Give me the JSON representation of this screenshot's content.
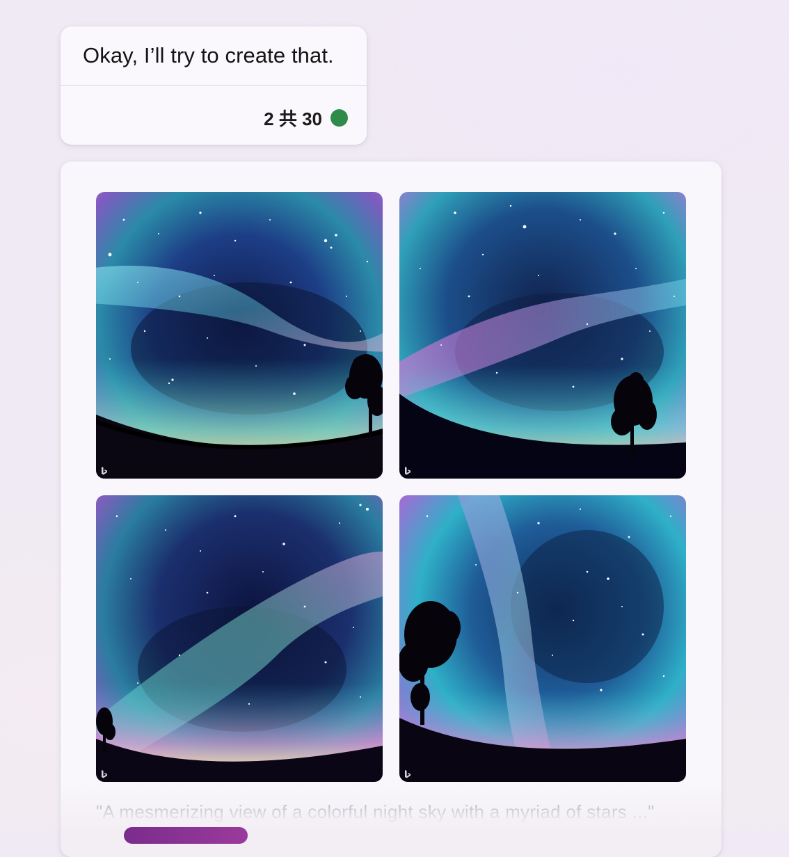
{
  "message": {
    "text": "Okay, I’ll try to create that.",
    "turn_counter": "2 共 30",
    "status_color": "#2e8b4a"
  },
  "image_grid": {
    "images": [
      {
        "icon": "bing-logo"
      },
      {
        "icon": "bing-logo"
      },
      {
        "icon": "bing-logo"
      },
      {
        "icon": "bing-logo"
      }
    ],
    "caption": "\"A mesmerizing view of a colorful night sky with a myriad of stars ...\""
  },
  "colors": {
    "bubble_bg": "#faf8fc",
    "card_bg": "#f9f7fb",
    "bottom_pill": "#8a3394"
  }
}
